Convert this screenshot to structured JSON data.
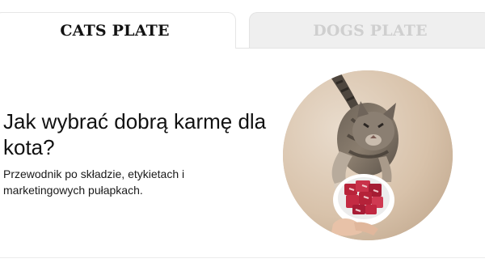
{
  "tabs": {
    "cats": "CATS PLATE",
    "dogs": "DOGS PLATE"
  },
  "article": {
    "title": "Jak wybrać dobrą karmę dla kota?",
    "subtitle": "Przewodnik po składzie, etykietach i marketingowych pułapkach."
  },
  "colors": {
    "tab_active_bg": "#ffffff",
    "tab_inactive_bg": "#efefef",
    "tab_inactive_text": "#cfcfcf",
    "text": "#111111"
  }
}
